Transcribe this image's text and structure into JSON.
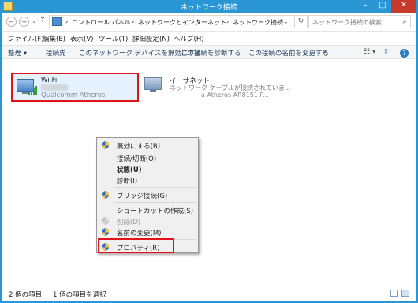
{
  "window": {
    "title": "ネットワーク接続",
    "min": "–",
    "max": "□",
    "close": "✕"
  },
  "address": {
    "back": "←",
    "forward": "→",
    "recent": "⌄",
    "up": "↑",
    "sep": "›",
    "crumbs": [
      "コントロール パネル",
      "ネットワークとインターネット",
      "ネットワーク接続"
    ],
    "dropdown": "⌄",
    "refresh": "↻",
    "search_placeholder": "ネットワーク接続の検索",
    "search_glyph": "⌕"
  },
  "menubar": {
    "items": [
      "ファイル(F)",
      "編集(E)",
      "表示(V)",
      "ツール(T)",
      "詳細設定(N)",
      "ヘルプ(H)"
    ]
  },
  "commandbar": {
    "organize": "整理 ▾",
    "items": [
      "接続先",
      "このネットワーク デバイスを無効にする",
      "この接続を診断する",
      "この接続の名前を変更する"
    ],
    "more": "»",
    "view_glyph": "☷ ▾",
    "pane_glyph": "▯",
    "help_glyph": "?"
  },
  "connections": [
    {
      "name": "Wi-Fi",
      "device": "Qualcomm Atheros"
    },
    {
      "name": "イーサネット",
      "status": "ネットワーク ケーブルが接続されていま...",
      "device": "a Atheros AR8151 P..."
    }
  ],
  "context_menu": {
    "items": [
      {
        "label": "無効にする(B)",
        "shield": true
      },
      {
        "label": "接続/切断(O)"
      },
      {
        "label": "状態(U)",
        "bold": true
      },
      {
        "label": "診断(I)"
      },
      {
        "label": "ブリッジ接続(G)",
        "shield": true
      },
      {
        "label": "ショートカットの作成(S)"
      },
      {
        "label": "削除(D)",
        "shield": true,
        "disabled": true
      },
      {
        "label": "名前の変更(M)",
        "shield": true
      },
      {
        "label": "プロパティ(R)",
        "shield": true
      }
    ]
  },
  "status": {
    "count": "2 個の項目",
    "selected": "1 個の項目を選択"
  },
  "colors": {
    "title_bg": "#2a97d4",
    "highlight": "#e0131b",
    "selection": "#cde8ff"
  }
}
